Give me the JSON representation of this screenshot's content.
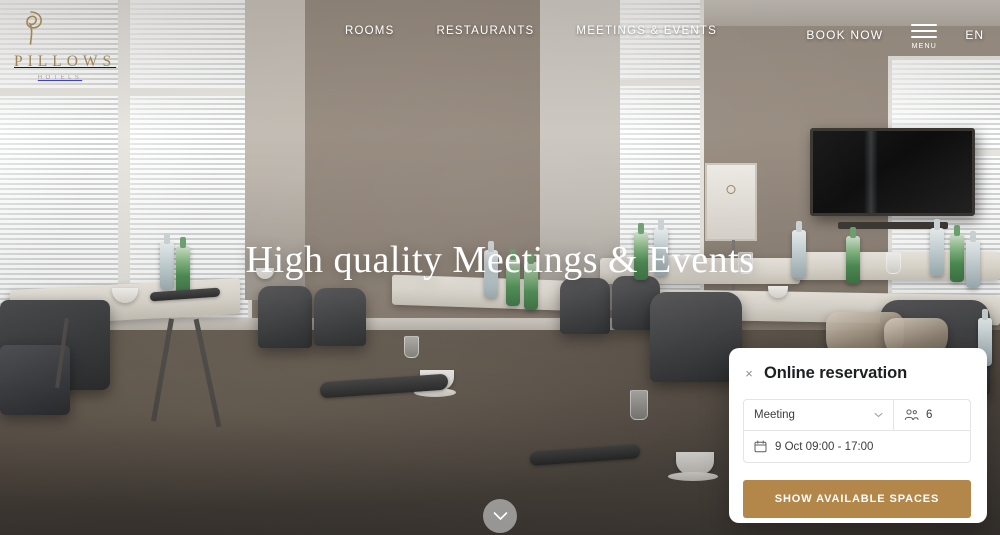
{
  "brand": {
    "name": "PILLOWS",
    "tagline": "HOTELS",
    "logo_icon": "pillows-spiral-logo-icon",
    "gold": "#a08554"
  },
  "header": {
    "nav": [
      {
        "label": "ROOMS",
        "name": "rooms"
      },
      {
        "label": "RESTAURANTS",
        "name": "restaurants"
      },
      {
        "label": "MEETINGS & EVENTS",
        "name": "meetings-events"
      }
    ],
    "book_now": "BOOK NOW",
    "menu_label": "MENU",
    "menu_icon": "hamburger-menu-icon",
    "language": "EN"
  },
  "hero": {
    "title": "High quality Meetings & Events",
    "scroll_icon": "chevron-down-icon"
  },
  "reservation": {
    "title": "Online reservation",
    "close_icon": "close-icon",
    "close_label": "×",
    "type": {
      "value": "Meeting",
      "chevron_icon": "chevron-down-icon"
    },
    "guests": {
      "value": "6",
      "icon": "people-icon"
    },
    "date": {
      "value": "9 Oct 09:00 - 17:00",
      "icon": "calendar-icon"
    },
    "cta_label": "SHOW AVAILABLE SPACES",
    "cta_color": "#b3864a"
  }
}
